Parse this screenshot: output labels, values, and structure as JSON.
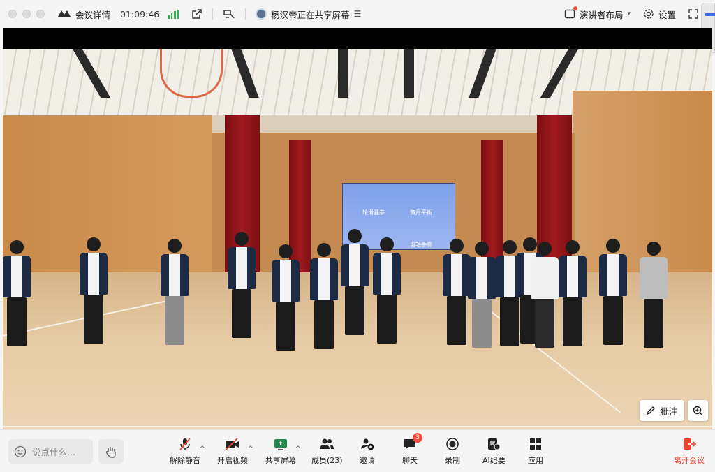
{
  "topbar": {
    "meeting_details_label": "会议详情",
    "timer": "01:09:46",
    "sharing_status": "杨汉帝正在共享屏幕",
    "presenter_layout_label": "演讲者布局",
    "settings_label": "设置"
  },
  "video": {
    "screen_texts": [
      "轮滑骚拳",
      "策月平衡",
      "羽毛手脚"
    ],
    "annotate_label": "批注"
  },
  "toolbar": {
    "chat_placeholder": "说点什么...",
    "unmute_label": "解除静音",
    "start_video_label": "开启视频",
    "share_screen_label": "共享屏幕",
    "members_label": "成员(23)",
    "invite_label": "邀请",
    "chat_label": "聊天",
    "chat_badge": "3",
    "record_label": "录制",
    "ai_minutes_label": "AI纪要",
    "apps_label": "应用",
    "leave_label": "离开会议"
  },
  "colors": {
    "accent": "#2f6fe3",
    "danger": "#e6462f",
    "signal": "#2bb24c",
    "badge": "#ef4a3c"
  }
}
